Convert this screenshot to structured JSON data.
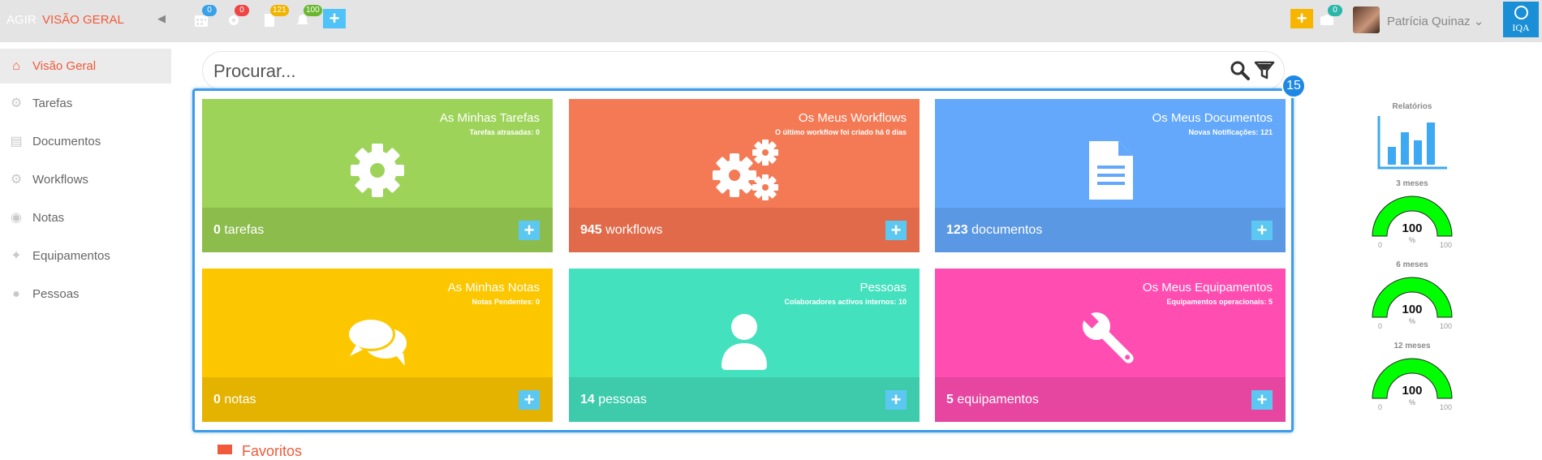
{
  "header": {
    "brand_prefix": "AGIR",
    "brand_title": "VISÃO GERAL",
    "badges": {
      "calendar": "0",
      "tasks": "0",
      "documents": "121",
      "notifications": "100",
      "messages": "0"
    },
    "user_name": "Patrícia Quinaz",
    "logo_text": "IQA"
  },
  "sidebar": {
    "items": [
      {
        "label": "Visão Geral",
        "icon": "home-icon"
      },
      {
        "label": "Tarefas",
        "icon": "gear-icon"
      },
      {
        "label": "Documentos",
        "icon": "document-icon"
      },
      {
        "label": "Workflows",
        "icon": "gears-icon"
      },
      {
        "label": "Notas",
        "icon": "comments-icon"
      },
      {
        "label": "Equipamentos",
        "icon": "wrench-icon"
      },
      {
        "label": "Pessoas",
        "icon": "user-icon"
      }
    ]
  },
  "search": {
    "placeholder": "Procurar..."
  },
  "step_badge": "15",
  "cards": [
    {
      "title": "As Minhas Tarefas",
      "subtitle": "Tarefas atrasadas: 0",
      "count": "0",
      "unit": "tarefas",
      "color": "#9ed35a",
      "foot_color": "#8cbc4c",
      "icon": "gear-icon"
    },
    {
      "title": "Os Meus Workflows",
      "subtitle": "O último workflow foi criado há 0 dias",
      "count": "945",
      "unit": "workflows",
      "color": "#f47a55",
      "foot_color": "#e06a49",
      "icon": "gears-icon"
    },
    {
      "title": "Os Meus Documentos",
      "subtitle": "Novas Notificações: 121",
      "count": "123",
      "unit": "documentos",
      "color": "#64a8fb",
      "foot_color": "#5b98e4",
      "icon": "document-icon"
    },
    {
      "title": "As Minhas Notas",
      "subtitle": "Notas Pendentes: 0",
      "count": "0",
      "unit": "notas",
      "color": "#fdc700",
      "foot_color": "#e3b300",
      "icon": "comments-icon"
    },
    {
      "title": "Pessoas",
      "subtitle": "Colaboradores activos internos: 10",
      "count": "14",
      "unit": "pessoas",
      "color": "#44e1bf",
      "foot_color": "#3dcbac",
      "icon": "user-icon"
    },
    {
      "title": "Os Meus Equipamentos",
      "subtitle": "Equipamentos operacionais: 5",
      "count": "5",
      "unit": "equipamentos",
      "color": "#ff4db2",
      "foot_color": "#e645a0",
      "icon": "wrench-icon"
    }
  ],
  "reports": {
    "label": "Relatórios",
    "gauges": [
      {
        "period": "3 meses",
        "value": "100",
        "unit": "%",
        "min": "0",
        "max": "100",
        "fill": 1.0
      },
      {
        "period": "6 meses",
        "value": "100",
        "unit": "%",
        "min": "0",
        "max": "100",
        "fill": 1.0
      },
      {
        "period": "12 meses",
        "value": "100",
        "unit": "%",
        "min": "0",
        "max": "100",
        "fill": 1.0
      }
    ],
    "gauge_color": "#00ff00"
  },
  "favorites": {
    "label": "Favoritos"
  }
}
